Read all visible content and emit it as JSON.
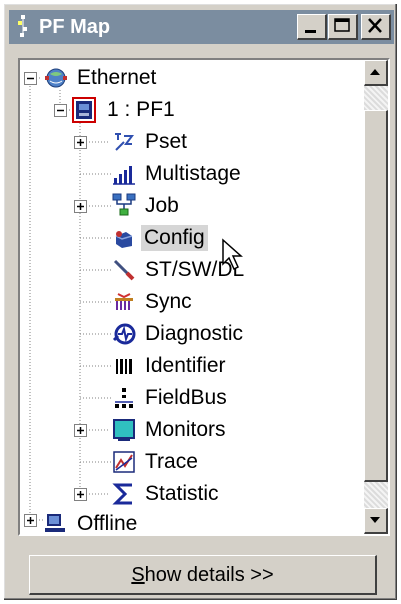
{
  "window": {
    "title": "PF Map"
  },
  "tree": {
    "ethernet": {
      "label": "Ethernet",
      "icon": "network-globe-icon",
      "expanded": true
    },
    "pf1": {
      "label": "1 : PF1",
      "icon": "controller-icon",
      "expanded": true
    },
    "children": [
      {
        "label": "Pset",
        "icon": "pset-icon",
        "expandable": true
      },
      {
        "label": "Multistage",
        "icon": "multistage-icon",
        "expandable": false
      },
      {
        "label": "Job",
        "icon": "job-icon",
        "expandable": true
      },
      {
        "label": "Config",
        "icon": "config-icon",
        "expandable": false,
        "selected": true
      },
      {
        "label": "ST/SW/DL",
        "icon": "screwdriver-icon",
        "expandable": false
      },
      {
        "label": "Sync",
        "icon": "sync-icon",
        "expandable": false
      },
      {
        "label": "Diagnostic",
        "icon": "diagnostic-icon",
        "expandable": false
      },
      {
        "label": "Identifier",
        "icon": "barcode-icon",
        "expandable": false
      },
      {
        "label": "FieldBus",
        "icon": "fieldbus-icon",
        "expandable": false
      },
      {
        "label": "Monitors",
        "icon": "monitor-icon",
        "expandable": true
      },
      {
        "label": "Trace",
        "icon": "trace-icon",
        "expandable": false
      },
      {
        "label": "Statistic",
        "icon": "sigma-icon",
        "expandable": true
      }
    ],
    "offline": {
      "label": "Offline",
      "icon": "offline-computer-icon",
      "expanded": false
    }
  },
  "footer": {
    "details_button_label_u": "S",
    "details_button_label_rest": "how details >>"
  },
  "colors": {
    "titlebar": "#7b8da0",
    "face": "#d4d0c8",
    "selection": "#d6d6d6"
  }
}
